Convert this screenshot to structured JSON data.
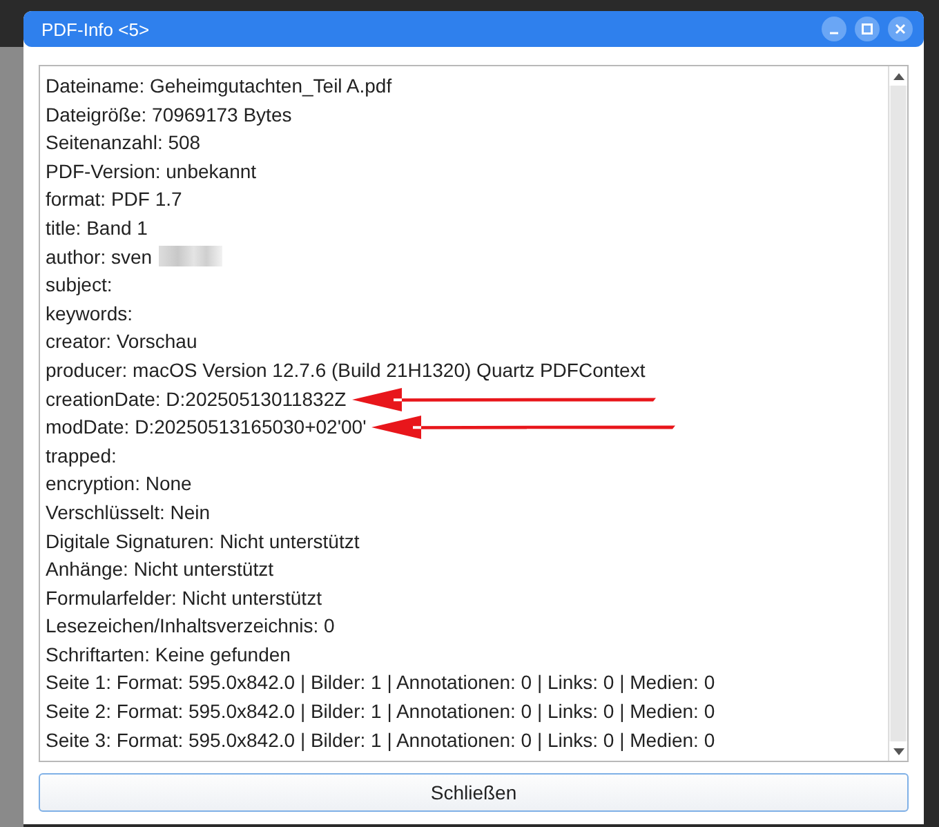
{
  "window": {
    "title": "PDF-Info <5>"
  },
  "info_lines": [
    {
      "text": "Dateiname: Geheimgutachten_Teil A.pdf",
      "redacted": false,
      "arrow": false
    },
    {
      "text": "Dateigröße: 70969173 Bytes",
      "redacted": false,
      "arrow": false
    },
    {
      "text": "Seitenanzahl: 508",
      "redacted": false,
      "arrow": false
    },
    {
      "text": "PDF-Version: unbekannt",
      "redacted": false,
      "arrow": false
    },
    {
      "text": "format: PDF 1.7",
      "redacted": false,
      "arrow": false
    },
    {
      "text": "title: Band 1",
      "redacted": false,
      "arrow": false
    },
    {
      "text": "author: sven",
      "redacted": true,
      "arrow": false
    },
    {
      "text": "subject:",
      "redacted": false,
      "arrow": false
    },
    {
      "text": "keywords:",
      "redacted": false,
      "arrow": false
    },
    {
      "text": "creator: Vorschau",
      "redacted": false,
      "arrow": false
    },
    {
      "text": "producer: macOS Version 12.7.6 (Build 21H1320) Quartz PDFContext",
      "redacted": false,
      "arrow": false
    },
    {
      "text": "creationDate: D:20250513011832Z",
      "redacted": false,
      "arrow": true
    },
    {
      "text": "modDate: D:20250513165030+02'00'",
      "redacted": false,
      "arrow": true
    },
    {
      "text": "trapped:",
      "redacted": false,
      "arrow": false
    },
    {
      "text": "encryption: None",
      "redacted": false,
      "arrow": false
    },
    {
      "text": "Verschlüsselt: Nein",
      "redacted": false,
      "arrow": false
    },
    {
      "text": "Digitale Signaturen: Nicht unterstützt",
      "redacted": false,
      "arrow": false
    },
    {
      "text": "Anhänge: Nicht unterstützt",
      "redacted": false,
      "arrow": false
    },
    {
      "text": "Formularfelder: Nicht unterstützt",
      "redacted": false,
      "arrow": false
    },
    {
      "text": "Lesezeichen/Inhaltsverzeichnis: 0",
      "redacted": false,
      "arrow": false
    },
    {
      "text": "Schriftarten: Keine gefunden",
      "redacted": false,
      "arrow": false
    },
    {
      "text": "Seite 1: Format: 595.0x842.0 | Bilder: 1 | Annotationen: 0 | Links: 0 | Medien: 0",
      "redacted": false,
      "arrow": false
    },
    {
      "text": "Seite 2: Format: 595.0x842.0 | Bilder: 1 | Annotationen: 0 | Links: 0 | Medien: 0",
      "redacted": false,
      "arrow": false
    },
    {
      "text": "Seite 3: Format: 595.0x842.0 | Bilder: 1 | Annotationen: 0 | Links: 0 | Medien: 0",
      "redacted": false,
      "arrow": false
    }
  ],
  "buttons": [
    {
      "label": "Schließen"
    }
  ]
}
